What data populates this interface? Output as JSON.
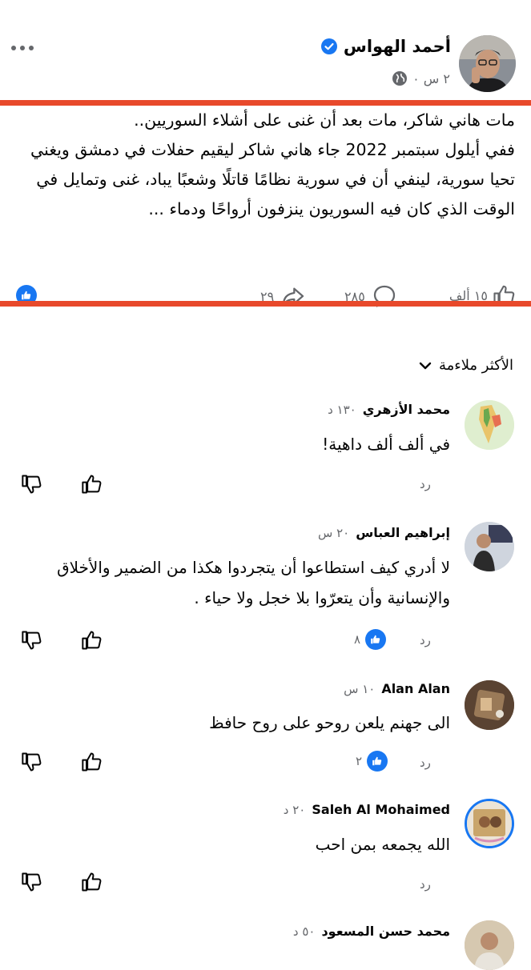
{
  "post": {
    "author": "أحمد الهواس",
    "time": "٢ س ٠",
    "lines": [
      "مات هاني شاكر، مات بعد أن غنى على أشلاء السوريين..",
      "ففي أيلول سبتمبر 2022 جاء هاني شاكر ليقيم حفلات في دمشق ويغني تحيا سورية، لينفي أن في سورية نظامًا قاتلًا وشعبًا يباد، غنى وتمايل في الوقت الذي كان فيه السوريون ينزفون أرواحًا ودماء ..."
    ],
    "stats": {
      "reactions": "١٥ ألف",
      "comments": "٢٨٥",
      "shares": "٢٩"
    }
  },
  "sort_label": "الأكثر ملاءمة",
  "reply_label": "رد",
  "comments": [
    {
      "name": "محمد الأزهري",
      "time": "١٣٠ د",
      "text": "في ألف ألف داهية!",
      "likes": ""
    },
    {
      "name": "إبراهيم العباس",
      "time": "٢٠ س",
      "text": "لا أدري  كيف استطاعوا أن يتجردوا هكذا من الضمير والأخلاق والإنسانية وأن يتعرّوا بلا خجل ولا حياء .",
      "likes": "٨"
    },
    {
      "name": "Alan Alan",
      "time": "١٠ س",
      "text": "الى جهنم يلعن روحو على روح حافظ",
      "likes": "٢"
    },
    {
      "name": "Saleh Al Mohaimed",
      "time": "٢٠ د",
      "text": "الله يجمعه بمن احب",
      "likes": ""
    },
    {
      "name": "محمد حسن المسعود",
      "time": "٥٠ د",
      "text": "",
      "likes": ""
    }
  ],
  "colors": {
    "accent": "#1877f2",
    "red_line": "#e8492b",
    "muted": "#65676b"
  }
}
